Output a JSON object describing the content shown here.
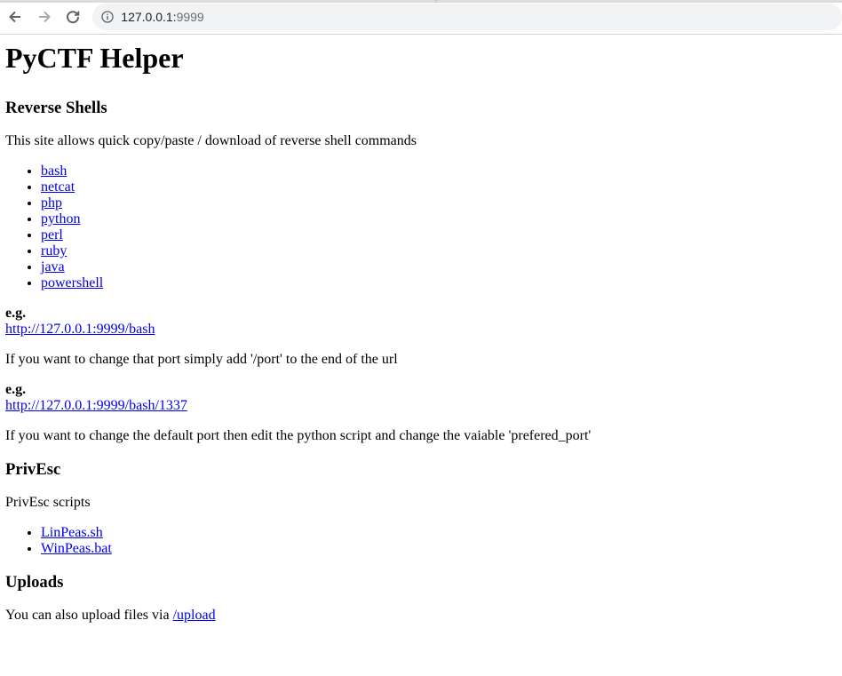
{
  "browser": {
    "url_host": "127.0.0.1:",
    "url_port": "9999"
  },
  "page": {
    "title": "PyCTF Helper",
    "reverse_shells": {
      "heading": "Reverse Shells",
      "intro": "This site allows quick copy/paste / download of reverse shell commands",
      "links": [
        "bash",
        "netcat",
        "php",
        "python",
        "perl",
        "ruby",
        "java",
        "powershell"
      ],
      "eg1_label": "e.g.",
      "eg1_link": "http://127.0.0.1:9999/bash",
      "port_text": "If you want to change that port simply add '/port' to the end of the url",
      "eg2_label": "e.g.",
      "eg2_link": "http://127.0.0.1:9999/bash/1337",
      "default_port_text": "If you want to change the default port then edit the python script and change the vaiable 'prefered_port'"
    },
    "privesc": {
      "heading": "PrivEsc",
      "intro": "PrivEsc scripts",
      "links": [
        "LinPeas.sh",
        "WinPeas.bat"
      ]
    },
    "uploads": {
      "heading": "Uploads",
      "text": "You can also upload files via ",
      "link": "/upload"
    }
  }
}
